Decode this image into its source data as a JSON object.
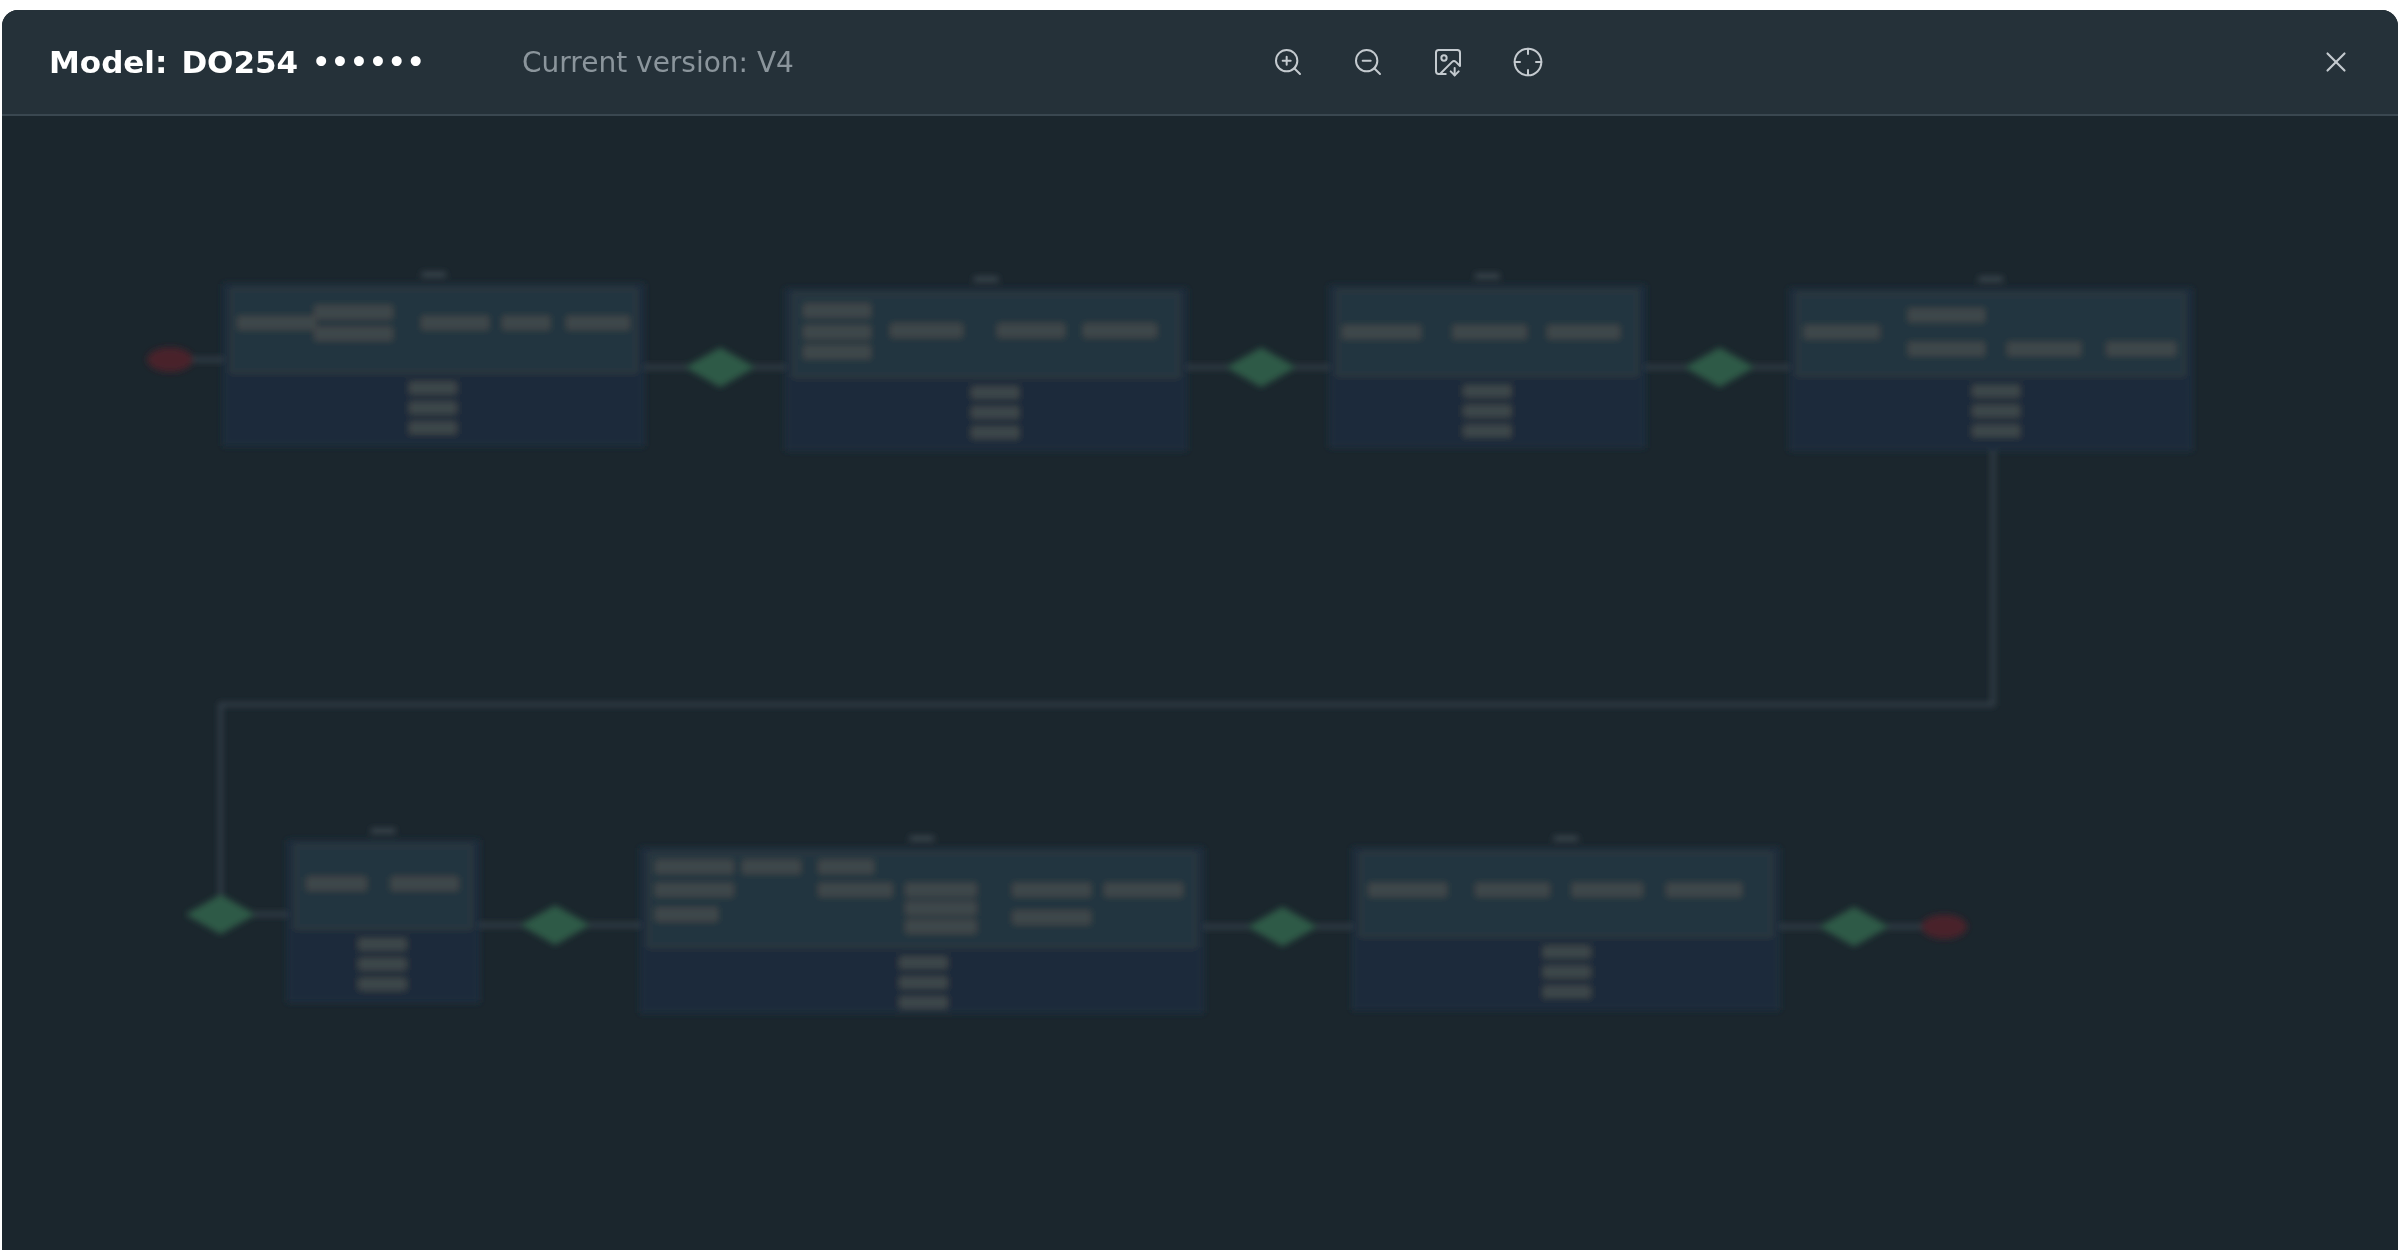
{
  "header": {
    "model_label": "Model:",
    "model_name": "DO254",
    "model_masked": "••••••",
    "version": "Current version: V4"
  },
  "toolbar": [
    {
      "kind": "zoom-in"
    },
    {
      "kind": "zoom-out"
    },
    {
      "kind": "export-image"
    },
    {
      "kind": "locate"
    }
  ],
  "close": {
    "kind": "close"
  }
}
